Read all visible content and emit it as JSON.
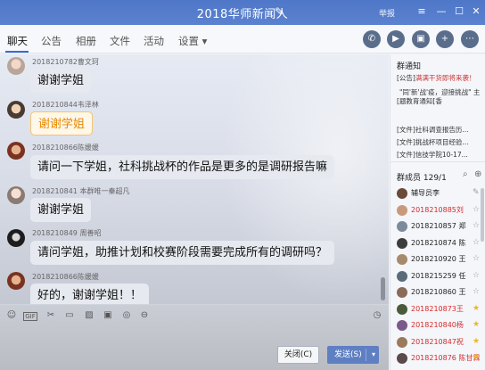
{
  "window": {
    "title": "2018华师新闻人",
    "report_label": "举报",
    "controls": [
      "≡",
      "—",
      "☐",
      "✕"
    ]
  },
  "tabs": [
    {
      "label": "聊天"
    },
    {
      "label": "公告"
    },
    {
      "label": "相册"
    },
    {
      "label": "文件"
    },
    {
      "label": "活动"
    },
    {
      "label": "设置 ▾"
    }
  ],
  "toolbar_icons": [
    "phone-icon",
    "video-icon",
    "screen-share-icon",
    "add-app-icon",
    "more-icon"
  ],
  "messages": [
    {
      "sender": "2018210782曹文珂",
      "text": "谢谢学姐",
      "style": "normal"
    },
    {
      "sender": "2018210844韦泽林",
      "text": "谢谢学姐",
      "style": "gold"
    },
    {
      "sender": "2018210866陈媛媛",
      "text": "请问一下学姐，社科挑战杯的作品是更多的是调研报告嘛",
      "style": "normal"
    },
    {
      "sender": "2018210841 本群唯一秦超凡",
      "text": "谢谢学姐",
      "style": "normal"
    },
    {
      "sender": "2018210849 周善昭",
      "text": "请问学姐，助推计划和校赛阶段需要完成所有的调研吗？",
      "style": "normal"
    },
    {
      "sender": "2018210866陈媛媛",
      "text": "好的，谢谢学姐！！",
      "style": "normal"
    }
  ],
  "input_tools": [
    "emoji-icon",
    "gif-icon",
    "scissors-icon",
    "folder-icon",
    "image-icon",
    "picture-icon",
    "shake-icon",
    "more-tool-icon"
  ],
  "buttons": {
    "close": "关闭(C)",
    "send": "发送(S)"
  },
  "group_notice": {
    "title": "群通知",
    "items": [
      {
        "prefix": "[公告]",
        "text": "满满干货即将来袭！"
      },
      {
        "prefix": "[",
        "text": "\"同'新'战'疫，迎接挑战\" 主题教育通知[香"
      },
      {
        "prefix": "[文件]",
        "text": "社科调查报告历..."
      },
      {
        "prefix": "[文件]",
        "text": "挑战杯项目经验..."
      },
      {
        "prefix": "[文件]",
        "text": "信技学院10-17..."
      }
    ]
  },
  "members": {
    "title": "群成员 129/1",
    "list": [
      {
        "name": "辅导员李",
        "red": false,
        "tag": "✎"
      },
      {
        "name": "2018210885刘",
        "red": true,
        "tag": "☆"
      },
      {
        "name": "2018210857 郑",
        "red": false,
        "tag": "☆"
      },
      {
        "name": "2018210874 陈",
        "red": false,
        "tag": "☆"
      },
      {
        "name": "2018210920 王",
        "red": false,
        "tag": "☆"
      },
      {
        "name": "2018215259 任",
        "red": false,
        "tag": "☆"
      },
      {
        "name": "2018210860 王",
        "red": false,
        "tag": "☆"
      },
      {
        "name": "2018210873王",
        "red": true,
        "tag": "★"
      },
      {
        "name": "2018210840杨",
        "red": true,
        "tag": "★"
      },
      {
        "name": "2018210847祝",
        "red": true,
        "tag": "★"
      },
      {
        "name": "2018210876 陈甘霖",
        "red": true,
        "tag": "★"
      }
    ]
  }
}
